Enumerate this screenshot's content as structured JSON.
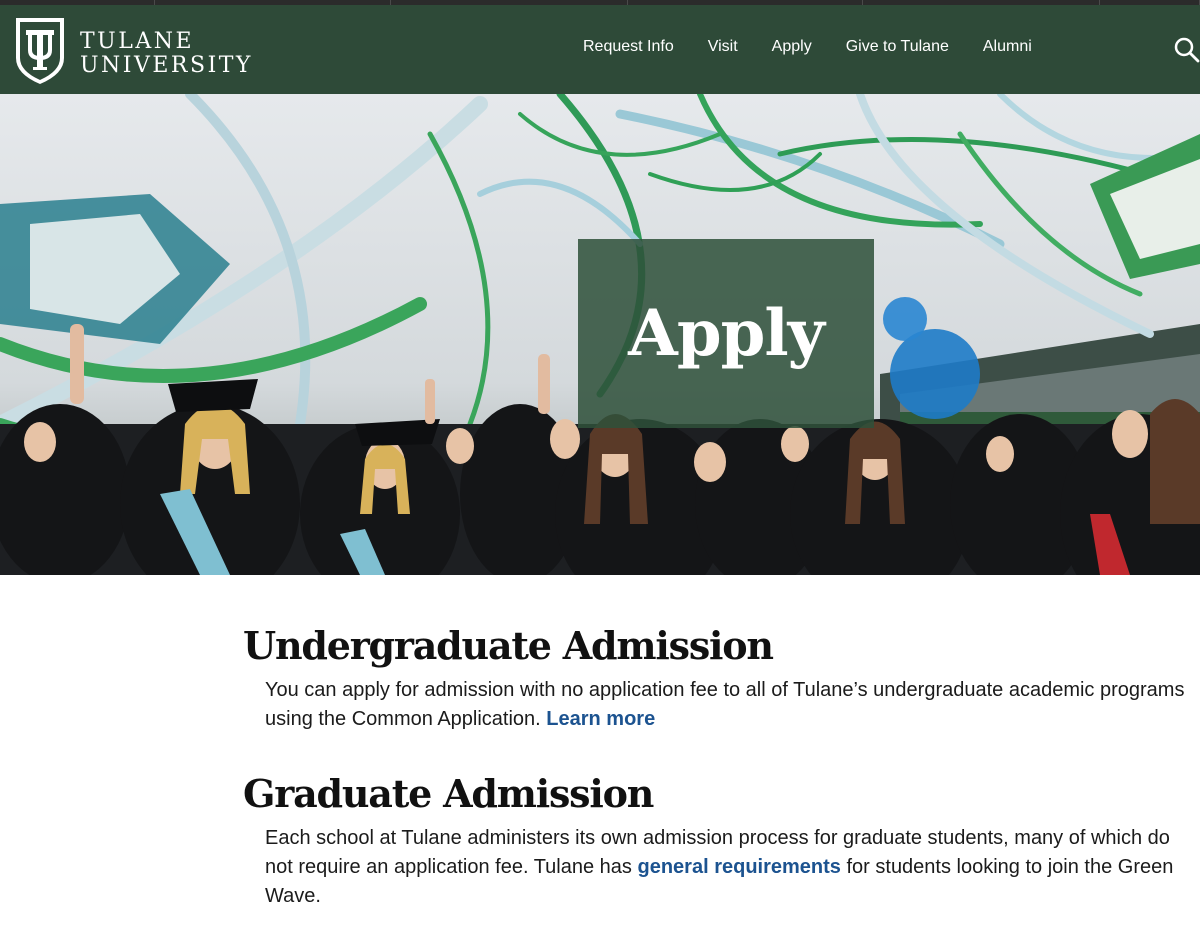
{
  "header": {
    "logo_line1": "TULANE",
    "logo_line2": "UNIVERSITY",
    "nav": [
      "Request Info",
      "Visit",
      "Apply",
      "Give to Tulane",
      "Alumni"
    ],
    "search_icon": "search-icon"
  },
  "hero": {
    "title": "Apply"
  },
  "sections": [
    {
      "heading": "Undergraduate Admission",
      "text_before": "You can apply for admission with no application fee to all of Tulane’s undergraduate academic programs using the Common Application.",
      "link": "Learn more",
      "text_after": ""
    },
    {
      "heading": "Graduate Admission",
      "text_before": "Each school at Tulane administers its own admission process for graduate students, many of which do not require an application fee. Tulane has",
      "link": "general requirements",
      "text_after": "for students looking to join the Green Wave."
    }
  ],
  "colors": {
    "header_bg": "#2e4a38",
    "link": "#1c5390",
    "hero_overlay": "#2e503a"
  }
}
